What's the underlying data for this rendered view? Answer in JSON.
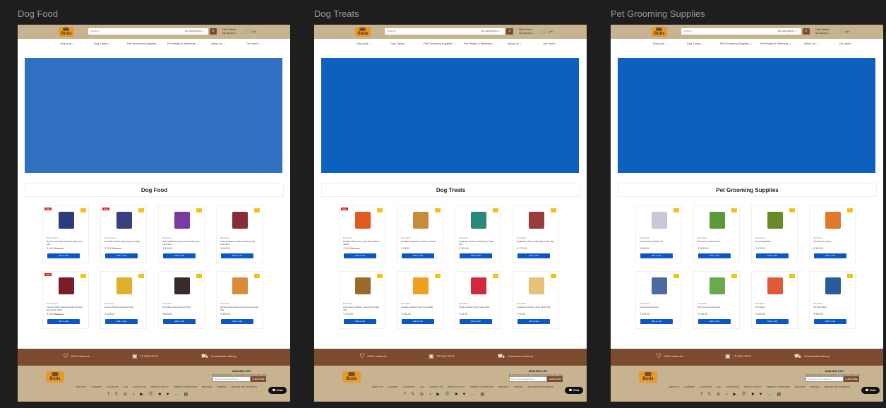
{
  "frames": [
    {
      "title": "Dog Food",
      "section_title": "Dog Food",
      "products": [
        {
          "sale": "Sale",
          "brand": "Pets empire",
          "name": "Royal Canin Maxi Adult Dry Dog Food 4Kg",
          "price": "₹ 940.00",
          "old": "₹ 999.00",
          "color": "#2c3c7a"
        },
        {
          "sale": "Sale",
          "brand": "Pets empire",
          "name": "Pure Bite Chicken Dry Dog Food 3Kg",
          "price": "₹ 799.00",
          "old": "₹ 850.00",
          "color": "#3a3f7d"
        },
        {
          "sale": "",
          "brand": "Pet brand",
          "name": "Natural Balance Dog Food Chicken Dry Food 3Kg",
          "price": "₹ 649.00",
          "old": "",
          "color": "#7a3aa0"
        },
        {
          "sale": "",
          "brand": "Pet brand",
          "name": "Natural Balance Adult Lamb Dry Dog Food 3Kg",
          "price": "₹ 699.00",
          "old": "",
          "color": "#8a2d3a"
        },
        {
          "sale": "Sale",
          "brand": "Pets empire",
          "name": "Farmina N&D Ancestral Grain Chicken Dog Food 2.5Kg",
          "price": "₹ 599.00",
          "old": "₹ 650.00",
          "color": "#7a1d2a"
        },
        {
          "sale": "",
          "brand": "Pet brand",
          "name": "Drools Chicken Dog Food 3Kg",
          "price": "₹ 449.00",
          "old": "",
          "color": "#e1b02a"
        },
        {
          "sale": "",
          "brand": "Pet brand",
          "name": "Pure Bite Oats Dog Food 3Kg",
          "price": "₹ 549.00",
          "old": "",
          "color": "#3a2a2a"
        },
        {
          "sale": "",
          "brand": "Pet brand",
          "name": "Drools Focus Super Premium Dog Food 3Kg",
          "price": "₹ 499.00",
          "old": "",
          "color": "#d98a3a"
        }
      ]
    },
    {
      "title": "Dog Treats",
      "section_title": "Dog Treats",
      "products": [
        {
          "sale": "Sale",
          "brand": "Pet brand",
          "name": "Pedigree Dentastix Large Dog Treats 7 Sticks",
          "price": "₹ 349.00",
          "old": "₹ 399.00",
          "color": "#e05a20"
        },
        {
          "sale": "",
          "brand": "Pet brand",
          "name": "Nutrapet Dog Bones Chicken 3 Pack",
          "price": "₹ 99.00",
          "old": "",
          "color": "#c78d3a"
        },
        {
          "sale": "",
          "brand": "Pet brand",
          "name": "Dogaholic Chicken Treats Dog Treats 70g",
          "price": "₹ 129.00",
          "old": "",
          "color": "#2a8a7a"
        },
        {
          "sale": "",
          "brand": "Pet brand",
          "name": "Dogaholic Lamb Treats Dog Treats 70g",
          "price": "₹ 179.00",
          "old": "",
          "color": "#9a3a3a"
        },
        {
          "sale": "",
          "brand": "Pet brand",
          "name": "Chip Chops Chicken Jerky Dog Treats 70g",
          "price": "₹ 179.00",
          "old": "",
          "color": "#9a6a2a"
        },
        {
          "sale": "",
          "brand": "Pet brand",
          "name": "Pedigree Chicken Dog Treats 80g",
          "price": "₹ 249.00",
          "old": "",
          "color": "#f0a020"
        },
        {
          "sale": "",
          "brand": "Pet brand",
          "name": "Drools Chicken Dog Treats 100g",
          "price": "₹ 49.00",
          "old": "",
          "color": "#d02a3a"
        },
        {
          "sale": "",
          "brand": "Pet brand",
          "name": "Dogaholic Chicken Jerky Sticks 70g",
          "price": "₹ 99.00",
          "old": "",
          "color": "#e6c27a"
        }
      ]
    },
    {
      "title": "Pet Grooming Supplies",
      "section_title": "Pet Grooming Supplies",
      "products": [
        {
          "sale": "",
          "brand": "Pet brand",
          "name": "Pet Grooming Starter Kit",
          "price": "₹ 299.00",
          "old": "",
          "color": "#c8c8d8"
        },
        {
          "sale": "",
          "brand": "Pet brand",
          "name": "Pet Grooming Kit Green",
          "price": "₹ 1199.00",
          "old": "",
          "color": "#5a9a3a"
        },
        {
          "sale": "",
          "brand": "Pet brand",
          "name": "Grooming Brush",
          "price": "₹ 179.00",
          "old": "",
          "color": "#6a8a2a"
        },
        {
          "sale": "",
          "brand": "Pet brand",
          "name": "Pet Perfume Spray",
          "price": "₹ 319.00",
          "old": "",
          "color": "#e07a2a"
        },
        {
          "sale": "",
          "brand": "Pet brand",
          "name": "Pet Grooming Glove",
          "price": "₹ 299.00",
          "old": "",
          "color": "#4a6aa0"
        },
        {
          "sale": "",
          "brand": "Pet brand",
          "name": "Pet Grooming Shampoo",
          "price": "₹ 199.00",
          "old": "",
          "color": "#6aaa4a"
        },
        {
          "sale": "",
          "brand": "Pet brand",
          "name": "Pet Wipes",
          "price": "₹ 199.00",
          "old": "",
          "color": "#e05a3a"
        },
        {
          "sale": "",
          "brand": "Pet brand",
          "name": "Pet Paw Balm",
          "price": "₹ 299.00",
          "old": "",
          "color": "#2a5a9a"
        }
      ]
    }
  ],
  "header": {
    "search_placeholder": "Search",
    "category": "All categories ⌄",
    "account_line1": "Hello Friend",
    "account_line2": "My account ⌄",
    "cart_label": "Cart"
  },
  "nav_items": [
    "Dog food ⌄",
    "Dog Treats ⌄",
    "Pet Grooming Supplies ⌄",
    "Pet Health & Wellness ⌄",
    "About us ⌄",
    "Our store ⌄"
  ],
  "add_to_cart": "Add to cart",
  "trust": {
    "authentic": "100% authentic",
    "returns": "15 days return",
    "delivery": "Guaranteed delivery"
  },
  "footer": {
    "mailing_title": "MAILING LIST",
    "mailing_sub": "Be the first to find out on exclusive promotions and events.",
    "email_placeholder": "Enter your email address",
    "subscribe": "SUBSCRIBE",
    "links": [
      "ABOUT US",
      "CAREERS",
      "LOCATIONS",
      "FAQ",
      "CONTACT US",
      "PRIVACY POLICY",
      "TERMS & CONDITIONS",
      "REFUNDS",
      "SITEMAP",
      "REFUND AND PAYMENTS"
    ],
    "social": "f 𝕏 ◎ ♪ ▶ ⓟ ■ ♥ … ▤",
    "chat": "Chat"
  },
  "colors": {
    "brand_tan": "#c7b38f",
    "brand_brown": "#7b4b2f",
    "banner_blue": "#0d60bd",
    "button_blue": "#0a57c7"
  }
}
